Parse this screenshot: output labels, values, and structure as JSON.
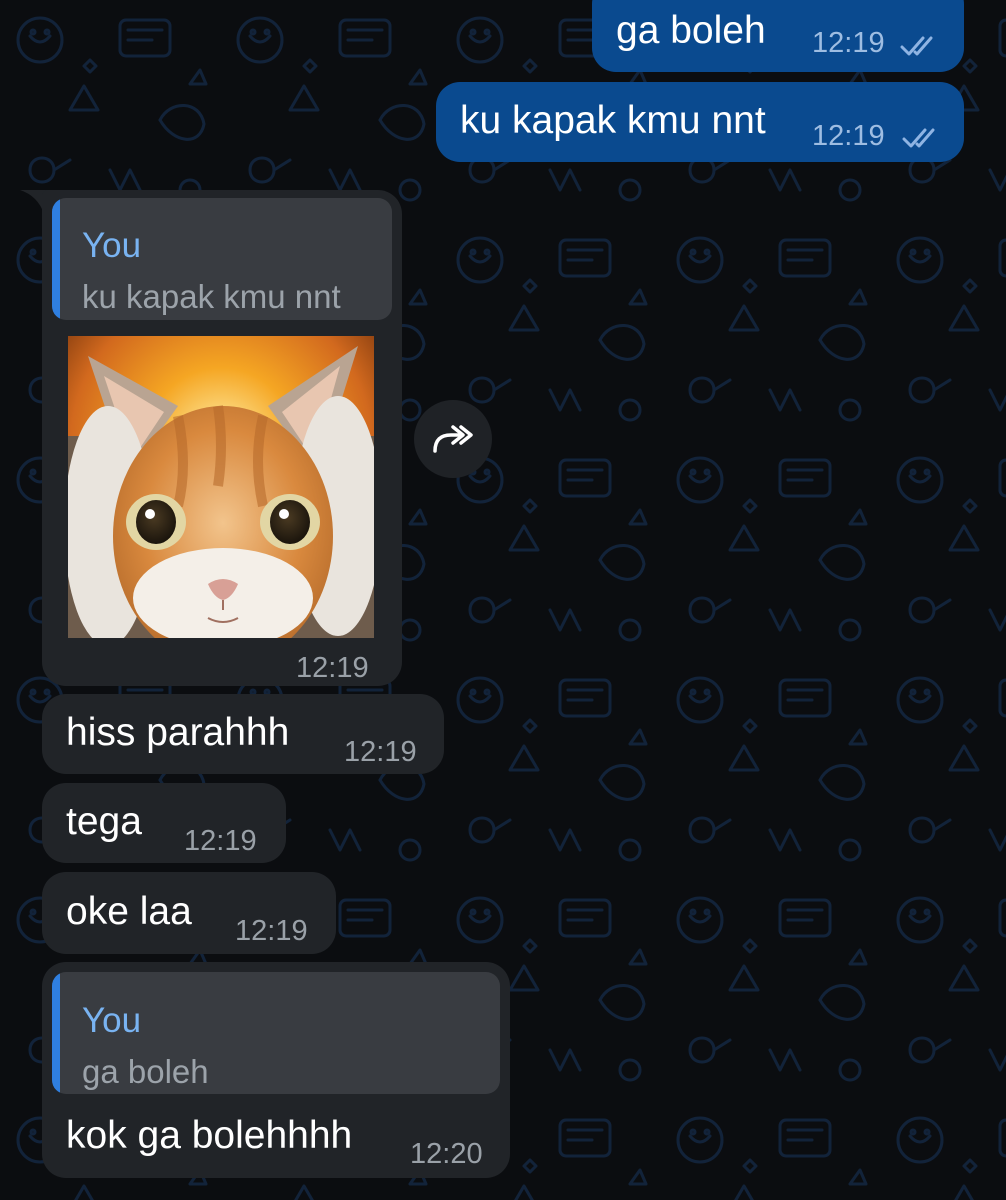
{
  "messages": [
    {
      "direction": "outgoing",
      "text": "ga boleh",
      "time": "12:19",
      "status": "read"
    },
    {
      "direction": "outgoing",
      "text": "ku kapak kmu nnt",
      "time": "12:19",
      "status": "read"
    },
    {
      "direction": "incoming",
      "type": "sticker",
      "reply": {
        "author": "You",
        "text": "ku kapak kmu nnt"
      },
      "time": "12:19"
    },
    {
      "direction": "incoming",
      "text": "hiss parahhh",
      "time": "12:19"
    },
    {
      "direction": "incoming",
      "text": "tega",
      "time": "12:19"
    },
    {
      "direction": "incoming",
      "text": "oke laa",
      "time": "12:19"
    },
    {
      "direction": "incoming",
      "reply": {
        "author": "You",
        "text": "ga boleh"
      },
      "text": "kok ga bolehhhh",
      "time": "12:20"
    }
  ],
  "icons": {
    "forward": "forward-icon",
    "read_receipt": "double-check-icon",
    "sticker": "cat-sticker"
  },
  "colors": {
    "background": "#0b0d10",
    "outgoing_bubble": "#0a4a8f",
    "incoming_bubble": "#212428",
    "quote_accent": "#2f7fe0",
    "quote_author": "#79b3f1"
  }
}
